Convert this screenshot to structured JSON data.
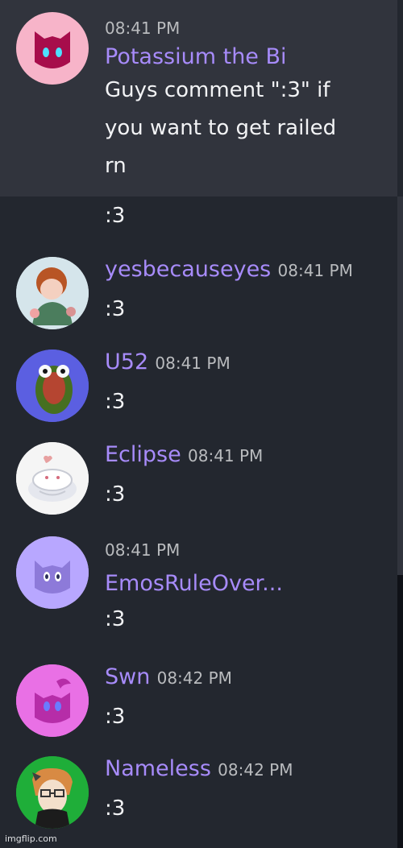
{
  "colors": {
    "background": "#23272f",
    "highlight": "#31343d",
    "username": "#a78bfa",
    "timestamp": "#b9bbbe",
    "text": "#f2f3f5"
  },
  "messages": [
    {
      "time": "08:41 PM",
      "name": "Potassium the Bi",
      "lines": [
        "Guys comment \":3\" if",
        "you want to get railed",
        "rn"
      ]
    },
    {
      "text": ":3"
    },
    {
      "name": "yesbecauseyes",
      "time": "08:41 PM",
      "text": ":3"
    },
    {
      "name": "U52",
      "time": "08:41 PM",
      "text": ":3"
    },
    {
      "name": "Eclipse",
      "time": "08:41 PM",
      "text": ":3"
    },
    {
      "time": "08:41 PM",
      "name": "EmosRuleOver...",
      "text": ":3"
    },
    {
      "name": "Swn",
      "time": "08:42 PM",
      "text": ":3"
    },
    {
      "name": "Nameless",
      "time": "08:42 PM",
      "text": ":3"
    }
  ],
  "footer": {
    "watermark": "imgflip.com"
  }
}
